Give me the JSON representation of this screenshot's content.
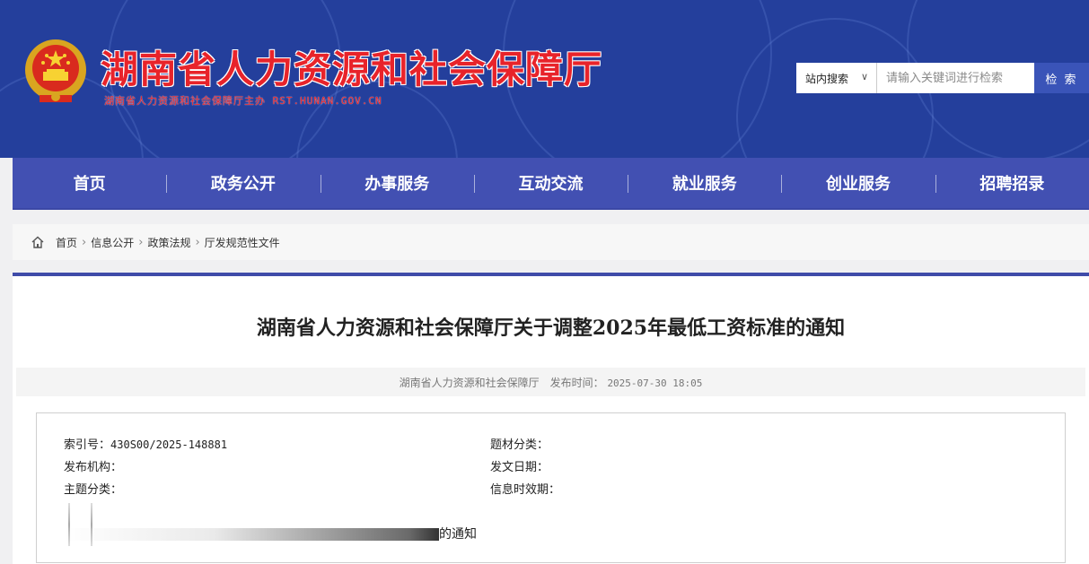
{
  "header": {
    "title": "湖南省人力资源和社会保障厅",
    "subtitle": "湖南省人力资源和社会保障厅主办  RST.HUNAN.GOV.CN",
    "search_scope": "站内搜索",
    "search_placeholder": "请输入关键词进行检索",
    "search_button": "检 索"
  },
  "nav": {
    "items": [
      "首页",
      "政务公开",
      "办事服务",
      "互动交流",
      "就业服务",
      "创业服务",
      "招聘招录"
    ]
  },
  "breadcrumb": [
    "首页",
    "信息公开",
    "政策法规",
    "厅发规范性文件"
  ],
  "article": {
    "title": "湖南省人力资源和社会保障厅关于调整2025年最低工资标准的通知",
    "publisher": "湖南省人力资源和社会保障厅",
    "publish_label": "发布时间：",
    "publish_time": "2025-07-30 18:05"
  },
  "info": {
    "index_label": "索引号：",
    "index_value": "430S00/2025-148881",
    "issuer_label": "发布机构：",
    "topic_label": "主题分类：",
    "genre_label": "题材分类：",
    "date_label": "发文日期：",
    "validity_label": "信息时效期：",
    "name_tail": "的通知"
  },
  "colors": {
    "header_bg": "#243f9c",
    "nav_bg": "#4250b2",
    "title_red": "#e8232a",
    "search_btn": "#3a54b8"
  }
}
